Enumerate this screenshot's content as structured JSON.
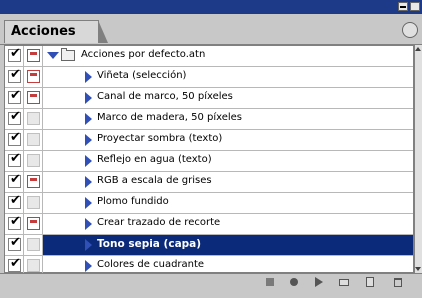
{
  "panel": {
    "tab_label": "Acciones"
  },
  "rows": [
    {
      "kind": "set",
      "label": "Acciones por defecto.atn",
      "checked": true,
      "dialog": true,
      "selected": false
    },
    {
      "kind": "action",
      "label": "Viñeta (selección)",
      "checked": true,
      "dialog": true,
      "selected": false
    },
    {
      "kind": "action",
      "label": "Canal de marco, 50 píxeles",
      "checked": true,
      "dialog": true,
      "selected": false
    },
    {
      "kind": "action",
      "label": "Marco de madera, 50 píxeles",
      "checked": true,
      "dialog": false,
      "selected": false
    },
    {
      "kind": "action",
      "label": "Proyectar sombra (texto)",
      "checked": true,
      "dialog": false,
      "selected": false
    },
    {
      "kind": "action",
      "label": "Reflejo en agua (texto)",
      "checked": true,
      "dialog": false,
      "selected": false
    },
    {
      "kind": "action",
      "label": "RGB a escala de grises",
      "checked": true,
      "dialog": true,
      "selected": false
    },
    {
      "kind": "action",
      "label": "Plomo fundido",
      "checked": true,
      "dialog": false,
      "selected": false
    },
    {
      "kind": "action",
      "label": "Crear trazado de recorte",
      "checked": true,
      "dialog": true,
      "selected": false
    },
    {
      "kind": "action",
      "label": "Tono sepia (capa)",
      "checked": true,
      "dialog": false,
      "selected": true
    },
    {
      "kind": "action",
      "label": "Colores de cuadrante",
      "checked": true,
      "dialog": false,
      "selected": false
    }
  ],
  "colors": {
    "title_bar": "#1c3a88",
    "selection": "#0b2a7a",
    "dialog_toggle": "#c43c3c",
    "disclosure_triangle": "#3050b8"
  },
  "icons": {
    "toolbar": [
      "stop-icon",
      "record-icon",
      "play-icon",
      "new-set-icon",
      "new-action-icon",
      "delete-icon"
    ]
  }
}
